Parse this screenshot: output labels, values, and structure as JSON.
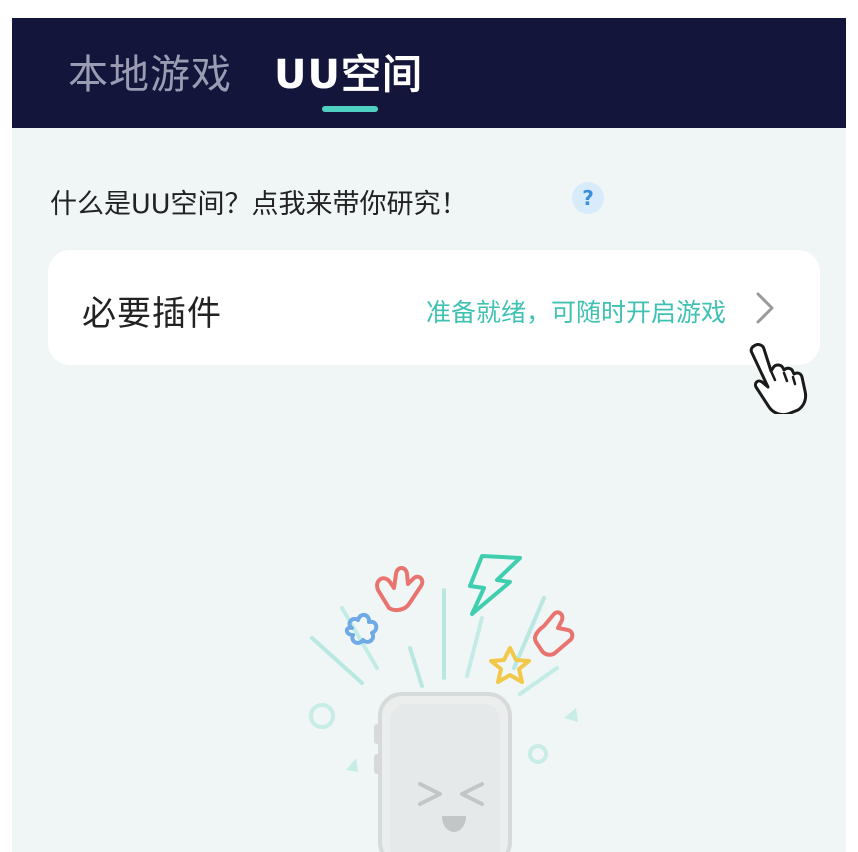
{
  "tabs": {
    "local_games": "本地游戏",
    "uu_space": "UU空间"
  },
  "help": {
    "text": "什么是UU空间？点我来带你研究！",
    "badge": "?"
  },
  "plugin_card": {
    "title": "必要插件",
    "status": "准备就绪，可随时开启游戏"
  },
  "colors": {
    "topbar": "#13163a",
    "accent": "#4ed1c2",
    "status_text": "#40c1b2",
    "background": "#eff6f5"
  },
  "icons": [
    "question-icon",
    "chevron-right-icon",
    "hand-cursor-icon",
    "phone-illustration"
  ]
}
